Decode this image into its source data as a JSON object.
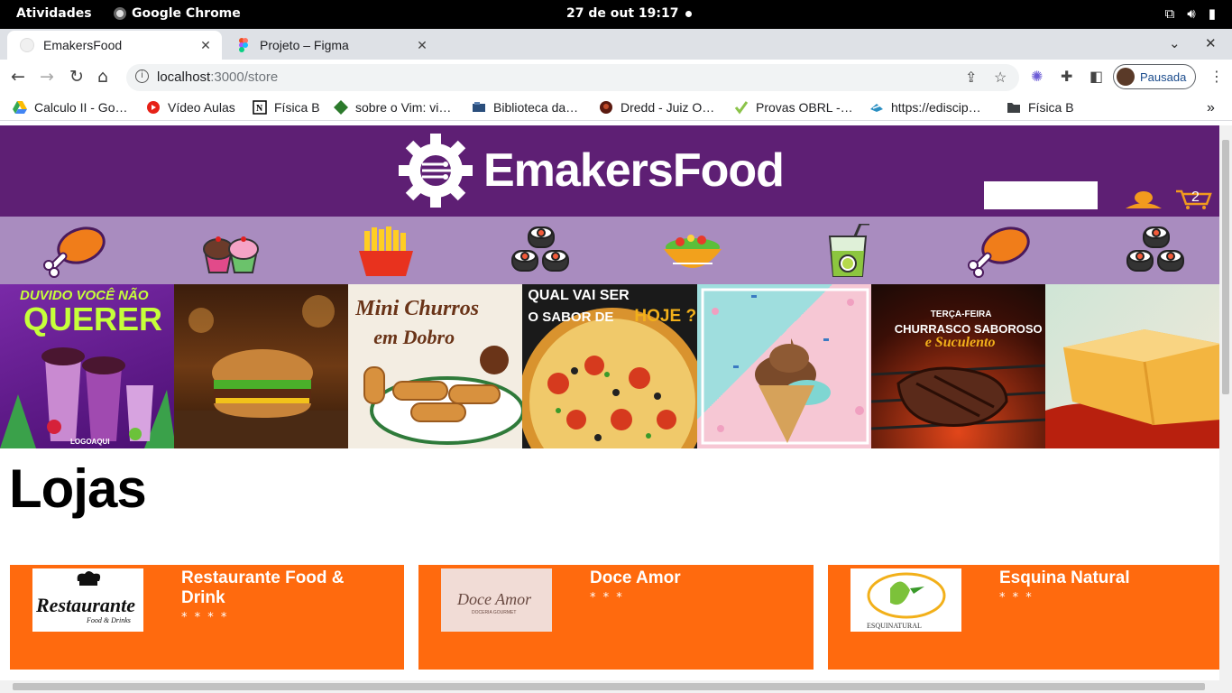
{
  "system_bar": {
    "activities": "Atividades",
    "app_name": "Google Chrome",
    "datetime": "27 de out  19:17"
  },
  "browser": {
    "tabs": [
      {
        "title": "EmakersFood",
        "active": true
      },
      {
        "title": "Projeto – Figma",
        "active": false
      }
    ],
    "url_host": "localhost",
    "url_path": ":3000/store",
    "profile_label": "Pausada",
    "bookmarks": [
      {
        "label": "Calculo II - Go…",
        "icon": "google-drive-icon"
      },
      {
        "label": "Vídeo Aulas",
        "icon": "youtube-icon"
      },
      {
        "label": "Física B",
        "icon": "notion-icon"
      },
      {
        "label": "sobre o Vim: vi…",
        "icon": "vim-icon"
      },
      {
        "label": "Biblioteca da…",
        "icon": "library-icon"
      },
      {
        "label": "Dredd - Juiz O…",
        "icon": "movie-icon"
      },
      {
        "label": "Provas OBRL -…",
        "icon": "check-icon"
      },
      {
        "label": "https://ediscip…",
        "icon": "edisciplinas-icon"
      },
      {
        "label": "Física B",
        "icon": "folder-icon"
      }
    ]
  },
  "site": {
    "brand": "EmakersFood",
    "cart_count": "2",
    "search_value": "",
    "categories": [
      "chicken-leg-icon",
      "cupcakes-icon",
      "fries-icon",
      "sushi-icon",
      "salad-icon",
      "juice-icon",
      "chicken-leg-icon",
      "sushi-icon"
    ],
    "banners": [
      {
        "name": "acai-banner",
        "lines": [
          "DUVIDO VOCÊ NÃO",
          "QUERER",
          "LOGOAQUI"
        ]
      },
      {
        "name": "burger-banner",
        "lines": []
      },
      {
        "name": "churros-banner",
        "lines": [
          "Mini Churros",
          "em Dobro"
        ]
      },
      {
        "name": "pizza-banner",
        "lines": [
          "QUAL VAI SER",
          "O SABOR DE",
          "HOJE ?"
        ]
      },
      {
        "name": "icecream-banner",
        "lines": []
      },
      {
        "name": "bbq-banner",
        "lines": [
          "TERÇA-FEIRA",
          "CHURRASCO SABOROSO",
          "e Suculento"
        ]
      },
      {
        "name": "pudding-banner",
        "lines": []
      }
    ],
    "section_title": "Lojas",
    "stores": [
      {
        "name": "Restaurante Food & Drink",
        "stars": "* * * *",
        "logo_text": "Restaurante",
        "logo_sub": "Food & Drinks"
      },
      {
        "name": "Doce Amor",
        "stars": "* * *",
        "logo_text": "Doce Amor",
        "logo_sub": "DOCERIA GOURMET"
      },
      {
        "name": "Esquina Natural",
        "stars": "* * *",
        "logo_text": "ESQUINATURAL",
        "logo_sub": ""
      }
    ]
  },
  "colors": {
    "header": "#5e1f74",
    "categories": "#a98cbf",
    "store_card": "#ff6a0e",
    "accent_orange": "#f29a1e"
  }
}
